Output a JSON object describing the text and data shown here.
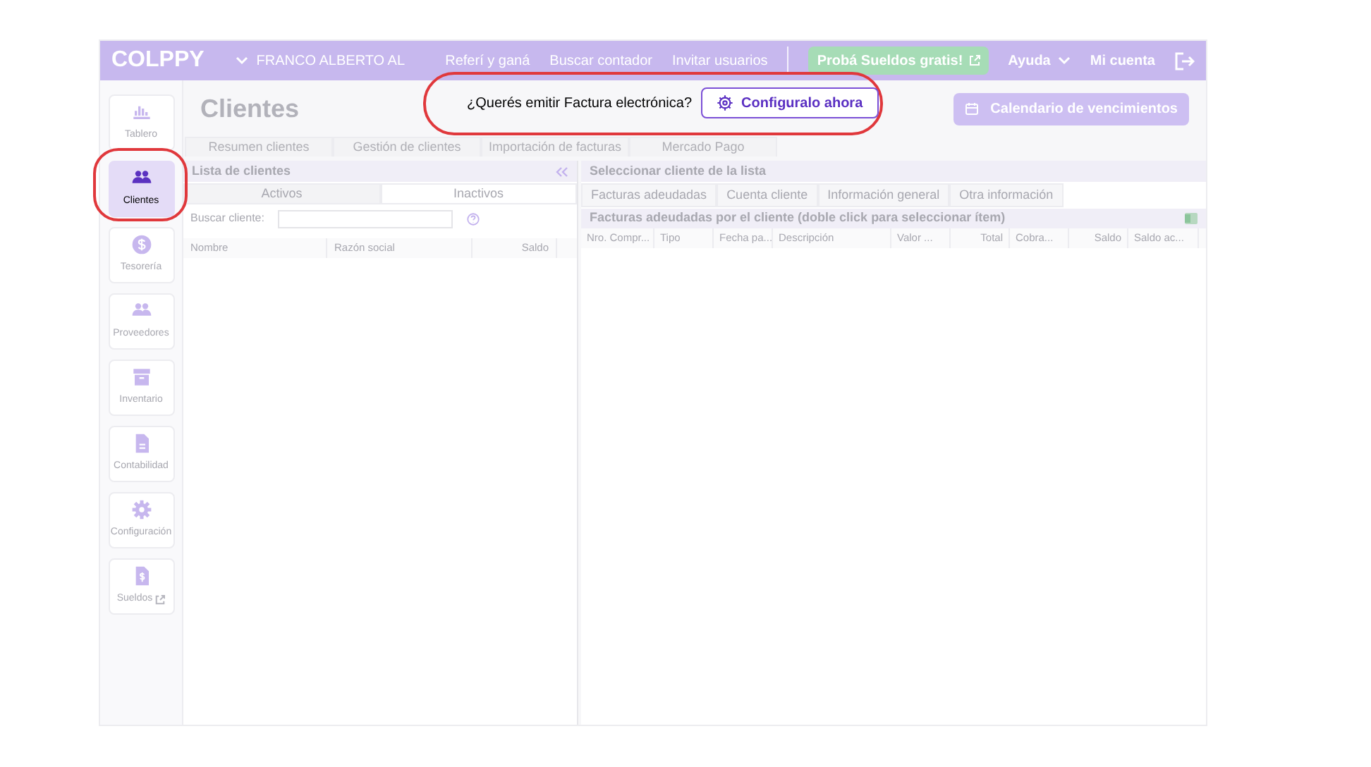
{
  "header": {
    "logo": "COLPPY",
    "company": "FRANCO ALBERTO AL",
    "nav": [
      "Referí y ganá",
      "Buscar contador",
      "Invitar usuarios"
    ],
    "promo": "Probá Sueldos gratis!",
    "help": "Ayuda",
    "account": "Mi cuenta"
  },
  "sidebar": [
    {
      "label": "Tablero",
      "kind": "chart",
      "selected": false
    },
    {
      "label": "Clientes",
      "kind": "people",
      "selected": true
    },
    {
      "label": "Tesorería",
      "kind": "dollar",
      "selected": false
    },
    {
      "label": "Proveedores",
      "kind": "people",
      "selected": false
    },
    {
      "label": "Inventario",
      "kind": "box",
      "selected": false
    },
    {
      "label": "Contabilidad",
      "kind": "doc",
      "selected": false
    },
    {
      "label": "Configuración",
      "kind": "gear",
      "selected": false
    },
    {
      "label": "Sueldos",
      "kind": "docdollar",
      "selected": false,
      "external": true
    }
  ],
  "page_title": "Clientes",
  "banner": {
    "question": "¿Querés emitir Factura electrónica?",
    "button": "Configuralo ahora"
  },
  "calendar_button": "Calendario de vencimientos",
  "tabs": [
    "Resumen clientes",
    "Gestión de clientes",
    "Importación de facturas",
    "Mercado Pago"
  ],
  "client_list": {
    "title": "Lista de clientes",
    "tabs": [
      {
        "label": "Activos",
        "selected": true
      },
      {
        "label": "Inactivos",
        "selected": false
      }
    ],
    "search_label": "Buscar cliente:",
    "columns": [
      "Nombre",
      "Razón social",
      "Saldo"
    ]
  },
  "detail": {
    "title": "Seleccionar cliente de la lista",
    "tabs": [
      "Facturas adeudadas",
      "Cuenta cliente",
      "Información general",
      "Otra información"
    ],
    "subtitle": "Facturas adeudadas por el cliente (doble click para seleccionar ítem)",
    "columns": [
      "Nro. Compr...",
      "Tipo",
      "Fecha pa...",
      "Descripción",
      "Valor ...",
      "Total",
      "Cobra...",
      "Saldo",
      "Saldo ac..."
    ]
  }
}
